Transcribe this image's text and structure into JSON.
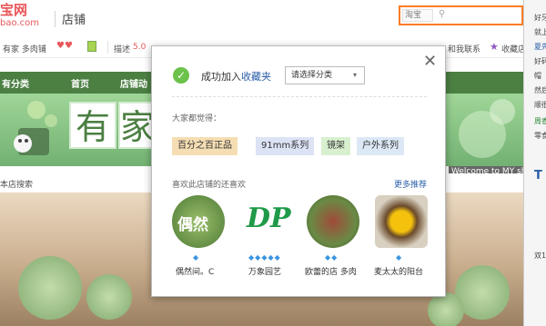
{
  "header": {
    "logo_main": "宝网",
    "logo_sub": "bao.com",
    "title": "店铺",
    "search": {
      "scope": "淘宝"
    }
  },
  "infobar": {
    "shop_name": "有家 多肉铺",
    "desc_label": "描述",
    "desc_score": "5.0",
    "contact": "和我联系",
    "favorite": "收藏店"
  },
  "nav": {
    "items": [
      "有分类",
      "首页",
      "店铺动"
    ]
  },
  "banner": {
    "chars": [
      "有",
      "家"
    ],
    "welcome": "Welcome to MY sh"
  },
  "store_search": "本店搜索",
  "right_panel": {
    "items": [
      "好牙",
      "就上",
      "夏先",
      "好码",
      "帽",
      "然后",
      "顺很",
      "周香",
      "零食",
      "双11"
    ]
  },
  "modal": {
    "success_prefix": "成功加入",
    "success_link": "收藏夹",
    "category_placeholder": "请选择分类",
    "tags_title": "大家都觉得：",
    "tags": [
      "百分之百正品",
      "91mm系列",
      "镜架",
      "户外系列"
    ],
    "recommend_title": "喜欢此店铺的还喜欢",
    "more": "更多推荐",
    "shops": [
      {
        "name": "偶然间。C",
        "badge": "偶然",
        "stars": 1
      },
      {
        "name": "万象园艺",
        "badge": "DP",
        "stars": 5
      },
      {
        "name": "欧蕾的店 多肉",
        "badge": "",
        "stars": 2
      },
      {
        "name": "麦太太的阳台",
        "badge": "",
        "stars": 1
      }
    ]
  },
  "colors": {
    "accent": "#e4393c",
    "search_border": "#ff6600",
    "nav_bg": "#2d6a23",
    "check": "#6cc24a",
    "link": "#2a5ea8"
  }
}
